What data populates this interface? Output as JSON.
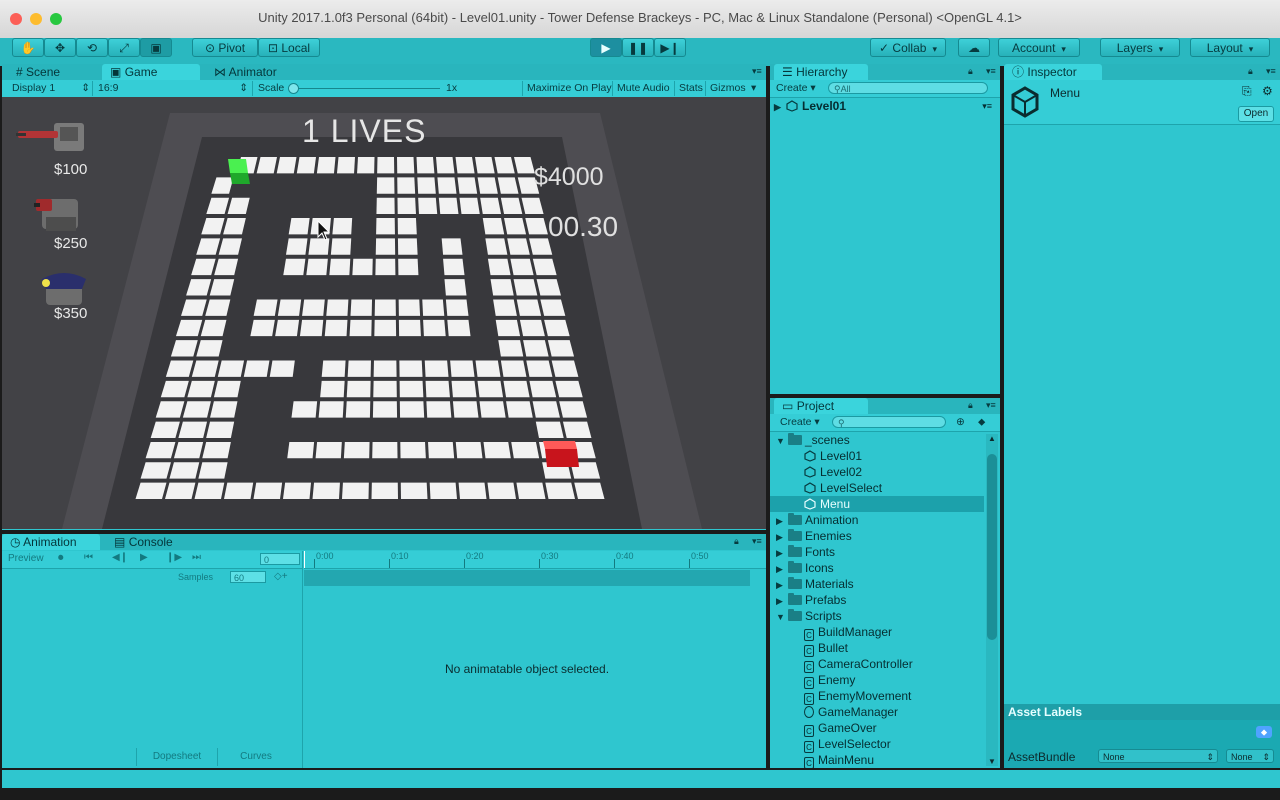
{
  "window": {
    "title": "Unity 2017.1.0f3 Personal (64bit) - Level01.unity - Tower Defense Brackeys - PC, Mac & Linux Standalone (Personal) <OpenGL 4.1>"
  },
  "toolbar": {
    "transform_tools": [
      "hand-icon",
      "move-icon",
      "rotate-icon",
      "scale-icon",
      "rect-tool-icon"
    ],
    "pivot_label": "Pivot",
    "local_label": "Local",
    "collab_label": "Collab",
    "account_label": "Account",
    "layers_label": "Layers",
    "layout_label": "Layout"
  },
  "tabs": {
    "scene": "Scene",
    "game": "Game",
    "animator": "Animator",
    "hierarchy": "Hierarchy",
    "inspector": "Inspector",
    "project": "Project",
    "animation": "Animation",
    "console": "Console"
  },
  "game_bar": {
    "display": "Display 1",
    "aspect": "16:9",
    "scale_label": "Scale",
    "scale_value": "1x",
    "maximize": "Maximize On Play",
    "mute": "Mute Audio",
    "stats": "Stats",
    "gizmos": "Gizmos"
  },
  "game": {
    "lives": "1 LIVES",
    "money": "$4000",
    "timer": "00.30",
    "shop": [
      {
        "price": "$100"
      },
      {
        "price": "$250"
      },
      {
        "price": "$350"
      }
    ]
  },
  "hierarchy": {
    "create": "Create",
    "search_placeholder": "All",
    "root": "Level01"
  },
  "inspector": {
    "name": "Menu",
    "open": "Open",
    "asset_labels": "Asset Labels",
    "asset_bundle": "AssetBundle",
    "bundle_value": "None",
    "variant_value": "None"
  },
  "project": {
    "create": "Create",
    "items": [
      {
        "label": "_scenes",
        "type": "folder-open",
        "indent": 0
      },
      {
        "label": "Level01",
        "type": "scene",
        "indent": 1
      },
      {
        "label": "Level02",
        "type": "scene",
        "indent": 1
      },
      {
        "label": "LevelSelect",
        "type": "scene",
        "indent": 1
      },
      {
        "label": "Menu",
        "type": "scene",
        "indent": 1,
        "selected": true
      },
      {
        "label": "Animation",
        "type": "folder",
        "indent": 0
      },
      {
        "label": "Enemies",
        "type": "folder",
        "indent": 0
      },
      {
        "label": "Fonts",
        "type": "folder",
        "indent": 0
      },
      {
        "label": "Icons",
        "type": "folder",
        "indent": 0
      },
      {
        "label": "Materials",
        "type": "folder",
        "indent": 0
      },
      {
        "label": "Prefabs",
        "type": "folder",
        "indent": 0
      },
      {
        "label": "Scripts",
        "type": "folder-open",
        "indent": 0
      },
      {
        "label": "BuildManager",
        "type": "script",
        "indent": 1
      },
      {
        "label": "Bullet",
        "type": "script",
        "indent": 1
      },
      {
        "label": "CameraController",
        "type": "script",
        "indent": 1
      },
      {
        "label": "Enemy",
        "type": "script",
        "indent": 1
      },
      {
        "label": "EnemyMovement",
        "type": "script",
        "indent": 1
      },
      {
        "label": "GameManager",
        "type": "script-globe",
        "indent": 1
      },
      {
        "label": "GameOver",
        "type": "script",
        "indent": 1
      },
      {
        "label": "LevelSelector",
        "type": "script",
        "indent": 1
      },
      {
        "label": "MainMenu",
        "type": "script",
        "indent": 1
      }
    ]
  },
  "animation": {
    "preview": "Preview",
    "frame": "0",
    "samples_label": "Samples",
    "samples_value": "60",
    "ruler": [
      "0:00",
      "0:10",
      "0:20",
      "0:30",
      "0:40",
      "0:50"
    ],
    "empty_message": "No animatable object selected.",
    "dopesheet": "Dopesheet",
    "curves": "Curves"
  },
  "colors": {
    "accent": "#2fc6cf",
    "tile": "#f2f2f2",
    "path": "#3a3a3e",
    "start": "#22c832",
    "end": "#d8242a"
  }
}
